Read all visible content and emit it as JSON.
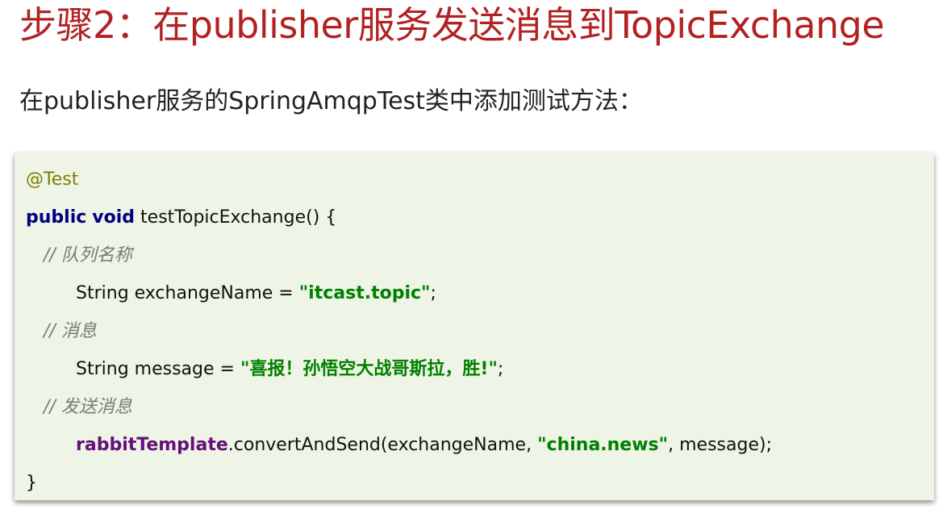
{
  "header": {
    "title": "步骤2：在publisher服务发送消息到TopicExchange",
    "subtitle": "在publisher服务的SpringAmqpTest类中添加测试方法："
  },
  "code": {
    "annotation": "@Test",
    "kw_public": "public",
    "kw_void": "void",
    "method_signature": "testTopicExchange() {",
    "comment_queue": "// 队列名称",
    "exchange_decl": "String exchangeName = ",
    "exchange_value": "\"itcast.topic\"",
    "semicolon1": ";",
    "comment_message": "// 消息",
    "message_decl": "String message = ",
    "message_value": "\"喜报！孙悟空大战哥斯拉，胜!\"",
    "semicolon2": ";",
    "comment_send": "// 发送消息",
    "template_field": "rabbitTemplate",
    "send_call_start": ".convertAndSend(exchangeName, ",
    "routing_key": "\"china.news\"",
    "send_call_end": ", message);",
    "closing_brace": "}"
  }
}
